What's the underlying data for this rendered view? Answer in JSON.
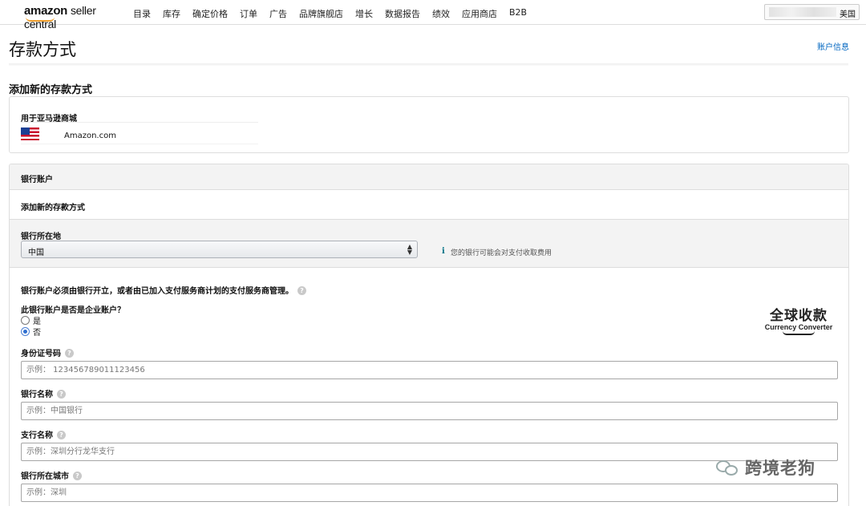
{
  "header": {
    "logo_brand": "amazon",
    "logo_suffix": "seller central",
    "nav": [
      "目录",
      "库存",
      "确定价格",
      "订单",
      "广告",
      "品牌旗舰店",
      "增长",
      "数据报告",
      "绩效",
      "应用商店",
      "B2B"
    ],
    "marketplace_label": "美国"
  },
  "page": {
    "title": "存款方式",
    "account_link": "账户信息",
    "section_heading": "添加新的存款方式"
  },
  "marketplace_box": {
    "label": "用于亚马逊商城",
    "site": "Amazon.com",
    "flag_icon": "us-flag-icon"
  },
  "bank": {
    "header": "银行账户",
    "add_method": "添加新的存款方式",
    "location_label": "银行所在地",
    "location_value": "中国",
    "info_icon": "i",
    "info_text": "您的银行可能会对支付收取费用",
    "note": "银行账户必须由银行开立，或者由已加入支付服务商计划的支付服务商管理。",
    "corporate_question": "此银行账户是否是企业账户？",
    "radio_yes": "是",
    "radio_no": "否",
    "selected": "否",
    "fields": [
      {
        "label": "身份证号码",
        "placeholder": "示例： 123456789011123456"
      },
      {
        "label": "银行名称",
        "placeholder": "示例：中国银行"
      },
      {
        "label": "支行名称",
        "placeholder": "示例：深圳分行龙华支行"
      },
      {
        "label": "银行所在城市",
        "placeholder": "示例：深圳"
      }
    ]
  },
  "currency_converter": {
    "cn": "全球收款",
    "en": "Currency Converter"
  },
  "watermark": {
    "text": "跨境老狗"
  }
}
